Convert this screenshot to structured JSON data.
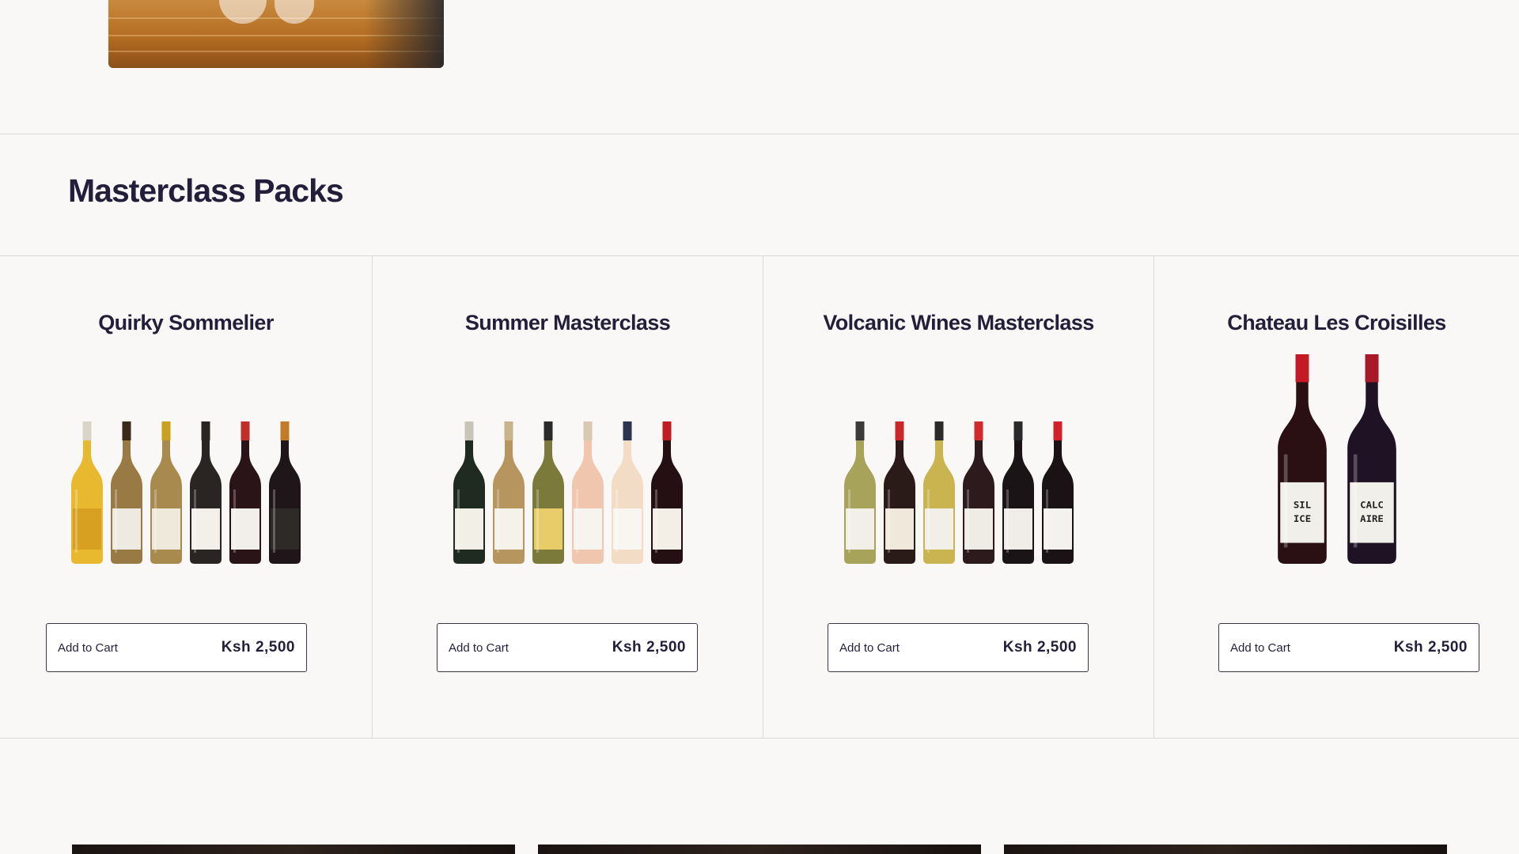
{
  "section": {
    "title": "Masterclass Packs"
  },
  "products": [
    {
      "name": "Quirky Sommelier",
      "cart_label": "Add to Cart",
      "price": "Ksh 2,500",
      "bottles": [
        {
          "glass": "#e8b92e",
          "cap": "#d9d4c8",
          "label": "#d8a020"
        },
        {
          "glass": "#9a7a44",
          "cap": "#3a2a1a",
          "label": "#eeeae2"
        },
        {
          "glass": "#a88a4e",
          "cap": "#c9a020",
          "label": "#efe9dc"
        },
        {
          "glass": "#2a2422",
          "cap": "#2a2422",
          "label": "#f3f0ea"
        },
        {
          "glass": "#2a1418",
          "cap": "#c0302a",
          "label": "#f1efea"
        },
        {
          "glass": "#1e1618",
          "cap": "#c07a2a",
          "label": "#2e2a28"
        }
      ]
    },
    {
      "name": "Summer Masterclass",
      "cart_label": "Add to Cart",
      "price": "Ksh 2,500",
      "bottles": [
        {
          "glass": "#1f2a20",
          "cap": "#c9c4b8",
          "label": "#f2efe6"
        },
        {
          "glass": "#b6955e",
          "cap": "#c8b48a",
          "label": "#f5f2ea"
        },
        {
          "glass": "#7c7a3a",
          "cap": "#2a2a2a",
          "label": "#e8cc6a"
        },
        {
          "glass": "#f0c6ae",
          "cap": "#d9c9b0",
          "label": "#f7f3ee"
        },
        {
          "glass": "#f3dcc6",
          "cap": "#2c3550",
          "label": "#f9f6f2"
        },
        {
          "glass": "#241012",
          "cap": "#c01c22",
          "label": "#f3eee6"
        }
      ]
    },
    {
      "name": "Volcanic Wines Masterclass",
      "cart_label": "Add to Cart",
      "price": "Ksh 2,500",
      "bottles": [
        {
          "glass": "#a8a35a",
          "cap": "#3a3a3a",
          "label": "#f2efe8"
        },
        {
          "glass": "#2a1a18",
          "cap": "#c8282a",
          "label": "#f1e8dc"
        },
        {
          "glass": "#c9b450",
          "cap": "#2a2a2a",
          "label": "#f2efe8"
        },
        {
          "glass": "#2c1a1c",
          "cap": "#d02a2a",
          "label": "#efece6"
        },
        {
          "glass": "#1a1416",
          "cap": "#2a2a2a",
          "label": "#f0ede8"
        },
        {
          "glass": "#1a1214",
          "cap": "#d0202a",
          "label": "#f4f2ee"
        }
      ]
    },
    {
      "name": "Chateau Les Croisilles",
      "cart_label": "Add to Cart",
      "price": "Ksh 2,500",
      "bottles": [
        {
          "glass": "#2a1012",
          "cap": "#c41a24",
          "label": "#f1efe9",
          "text": "SIL ICE"
        },
        {
          "glass": "#1e1224",
          "cap": "#a81a2a",
          "label": "#f1efe9",
          "text": "CALC AIRE"
        }
      ]
    }
  ]
}
